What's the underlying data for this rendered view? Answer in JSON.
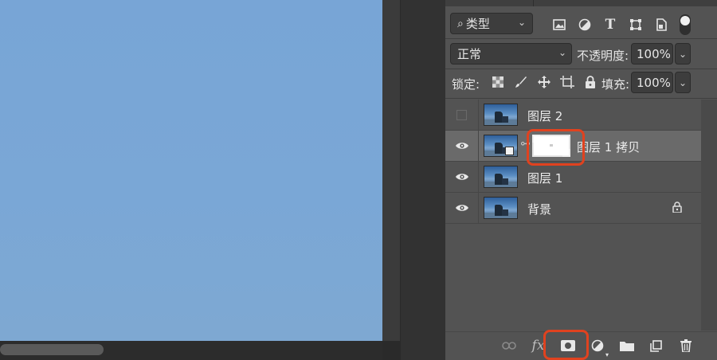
{
  "layers_panel": {
    "filter": {
      "kind_label": "类型",
      "search_icon": "search-icon"
    },
    "filter_icons": [
      "image-filter-icon",
      "adjustment-filter-icon",
      "type-filter-icon",
      "shape-filter-icon",
      "smart-object-filter-icon"
    ],
    "blend_mode": "正常",
    "opacity_label": "不透明度:",
    "opacity_value": "100%",
    "lock_label": "锁定:",
    "lock_icons": [
      "lock-transparent-pixels-icon",
      "lock-image-pixels-icon",
      "lock-position-icon",
      "lock-artboard-icon",
      "lock-all-icon"
    ],
    "fill_label": "填充:",
    "fill_value": "100%",
    "layers": [
      {
        "name": "图层 2",
        "visible": false,
        "selected": false,
        "has_mask": false,
        "locked": false
      },
      {
        "name": "图层 1 拷贝",
        "visible": true,
        "selected": true,
        "has_mask": true,
        "locked": false
      },
      {
        "name": "图层 1",
        "visible": true,
        "selected": false,
        "has_mask": false,
        "locked": false
      },
      {
        "name": "背景",
        "visible": true,
        "selected": false,
        "has_mask": false,
        "locked": true
      }
    ],
    "bottom_icons": [
      "link-layers-icon",
      "layer-style-fx-icon",
      "add-layer-mask-icon",
      "adjustment-layer-icon",
      "new-group-icon",
      "new-layer-icon",
      "delete-layer-icon"
    ],
    "bottom_fx_text": "fx",
    "highlight_color": "#e0421f"
  }
}
